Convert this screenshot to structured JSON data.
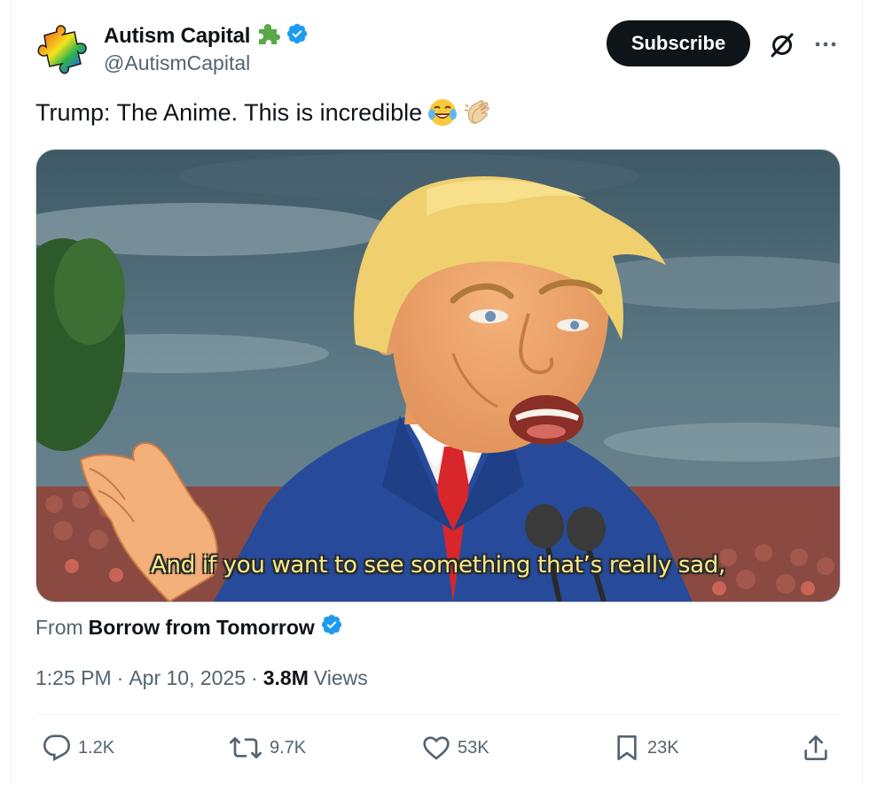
{
  "author": {
    "display_name": "Autism Capital",
    "handle": "@AutismCapital",
    "badge_icon": "puzzle-piece-icon",
    "verified_icon": "verified-badge-icon",
    "verified_color": "#1d9bf0"
  },
  "header": {
    "subscribe_label": "Subscribe",
    "grok_icon": "grok-icon",
    "more_icon": "more-options-icon"
  },
  "tweet": {
    "text": "Trump: The Anime. This is incredible",
    "emojis": [
      "face-with-tears-of-joy-icon",
      "clapping-hands-icon"
    ]
  },
  "media": {
    "subtitle": "And if you want to see something that’s really sad,"
  },
  "source": {
    "from_label": "From",
    "name": "Borrow from Tomorrow"
  },
  "meta": {
    "time": "1:25 PM",
    "separator": "·",
    "date": "Apr 10, 2025",
    "views_count": "3.8M",
    "views_label": "Views"
  },
  "actions": {
    "replies": "1.2K",
    "reposts": "9.7K",
    "likes": "53K",
    "bookmarks": "23K"
  },
  "colors": {
    "text_primary": "#0f1419",
    "text_secondary": "#536471",
    "accent": "#1d9bf0",
    "button_bg": "#0f1419"
  }
}
